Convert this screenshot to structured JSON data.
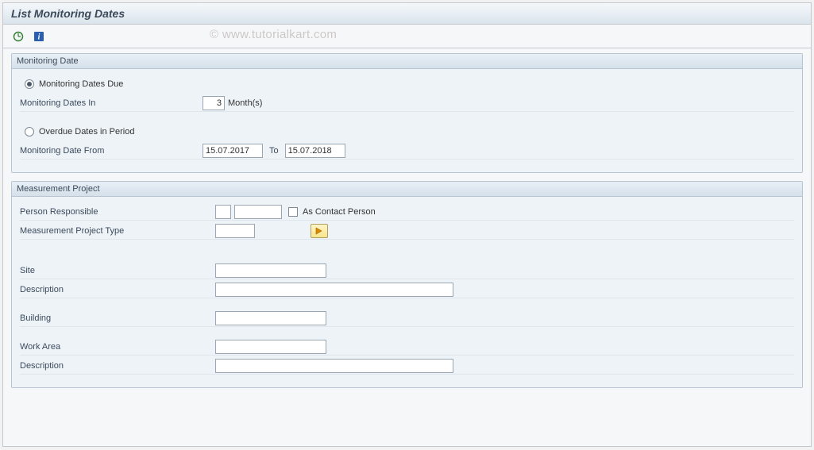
{
  "title": "List Monitoring Dates",
  "watermark": "© www.tutorialkart.com",
  "toolbar": {
    "execute_icon": "execute-icon",
    "info_icon": "info-icon"
  },
  "monitoring": {
    "group_title": "Monitoring Date",
    "radio_due": "Monitoring Dates Due",
    "dates_in_label": "Monitoring Dates In",
    "dates_in_value": "3",
    "dates_in_unit": "Month(s)",
    "radio_overdue": "Overdue Dates in Period",
    "date_from_label": "Monitoring Date From",
    "date_from_value": "15.07.2017",
    "to_label": "To",
    "date_to_value": "15.07.2018"
  },
  "project": {
    "group_title": "Measurement Project",
    "person_label": "Person Responsible",
    "person_code": "",
    "person_name": "",
    "contact_label": "As Contact Person",
    "type_label": "Measurement Project Type",
    "type_value": "",
    "site_label": "Site",
    "site_value": "",
    "description_label": "Description",
    "site_description": "",
    "building_label": "Building",
    "building_value": "",
    "workarea_label": "Work Area",
    "workarea_value": "",
    "workarea_description": ""
  }
}
